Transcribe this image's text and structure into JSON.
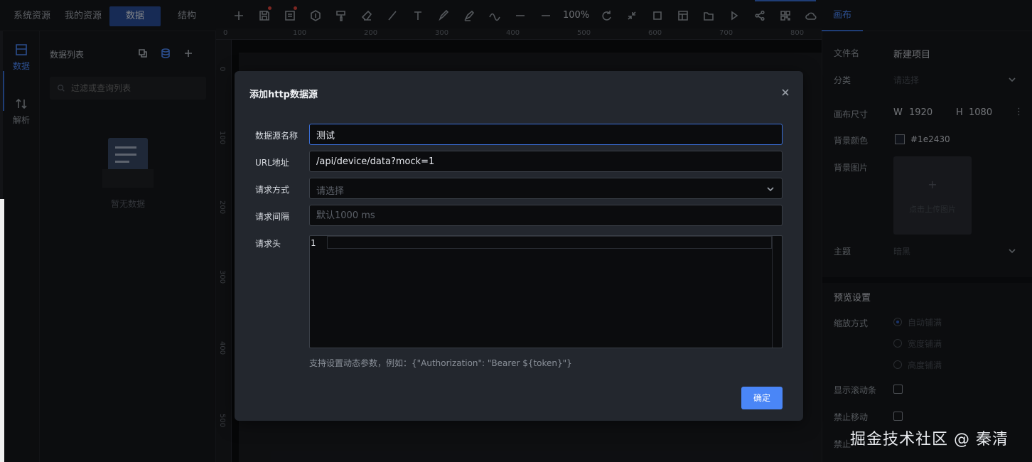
{
  "topbar": {
    "tabs": [
      {
        "label": "系统资源"
      },
      {
        "label": "我的资源"
      },
      {
        "label": "数据"
      },
      {
        "label": "结构"
      }
    ],
    "zoom_label": "100%",
    "right_tab_label": "画布",
    "tools": [
      "add-icon",
      "save-icon",
      "template-icon",
      "hexagon-icon",
      "brush-icon",
      "eraser-icon",
      "line-icon",
      "text-icon",
      "pen-icon",
      "highlighter-icon",
      "curve-icon",
      "dash-line-icon",
      "solid-line-icon",
      "refresh-icon",
      "collapse-icon",
      "square-icon",
      "layout-icon",
      "folder-icon",
      "play-icon",
      "share-icon",
      "qrcode-icon",
      "cloud-icon"
    ]
  },
  "rail": {
    "items": [
      {
        "label": "数据",
        "icon": "data-grid-icon"
      },
      {
        "label": "解析",
        "icon": "sort-arrows-icon"
      }
    ]
  },
  "data_panel": {
    "title": "数据列表",
    "search_placeholder": "过滤或查询列表",
    "empty_text": "暂无数据"
  },
  "ruler": {
    "top_ticks": [
      "0",
      "100",
      "200",
      "300",
      "400",
      "500",
      "600",
      "700",
      "800"
    ],
    "left_ticks": [
      "0",
      "100",
      "200",
      "300",
      "400",
      "500"
    ]
  },
  "canvas_settings": {
    "file_name_label": "文件名",
    "file_name_value": "新建项目",
    "category_label": "分类",
    "category_placeholder": "请选择",
    "size_label": "画布尺寸",
    "width_prefix": "W",
    "width_value": "1920",
    "height_prefix": "H",
    "height_value": "1080",
    "bg_color_label": "背景颜色",
    "bg_color_value": "#1e2430",
    "bg_image_label": "背景图片",
    "upload_plus": "+",
    "upload_text": "点击上传图片",
    "theme_label": "主题",
    "theme_value": "暗黑"
  },
  "preview_settings": {
    "section_title": "预览设置",
    "scale_label": "缩放方式",
    "scale_options": [
      "自动铺满",
      "宽度铺满",
      "高度铺满"
    ],
    "scrollbar_label": "显示滚动条",
    "no_move_label": "禁止移动",
    "no_zoom_label": "禁止"
  },
  "watermark": "掘金技术社区 @ 秦清",
  "modal": {
    "title": "添加http数据源",
    "close_icon": "close-icon",
    "fields": {
      "name_label": "数据源名称",
      "name_value": "测试",
      "url_label": "URL地址",
      "url_value": "/api/device/data?mock=1",
      "method_label": "请求方式",
      "method_placeholder": "请选择",
      "interval_label": "请求间隔",
      "interval_placeholder": "默认1000 ms",
      "headers_label": "请求头",
      "headers_line_number": "1"
    },
    "hint": "支持设置动态参数，例如：{\"Authorization\": \"Bearer ${token}\"}",
    "confirm_label": "确定"
  }
}
